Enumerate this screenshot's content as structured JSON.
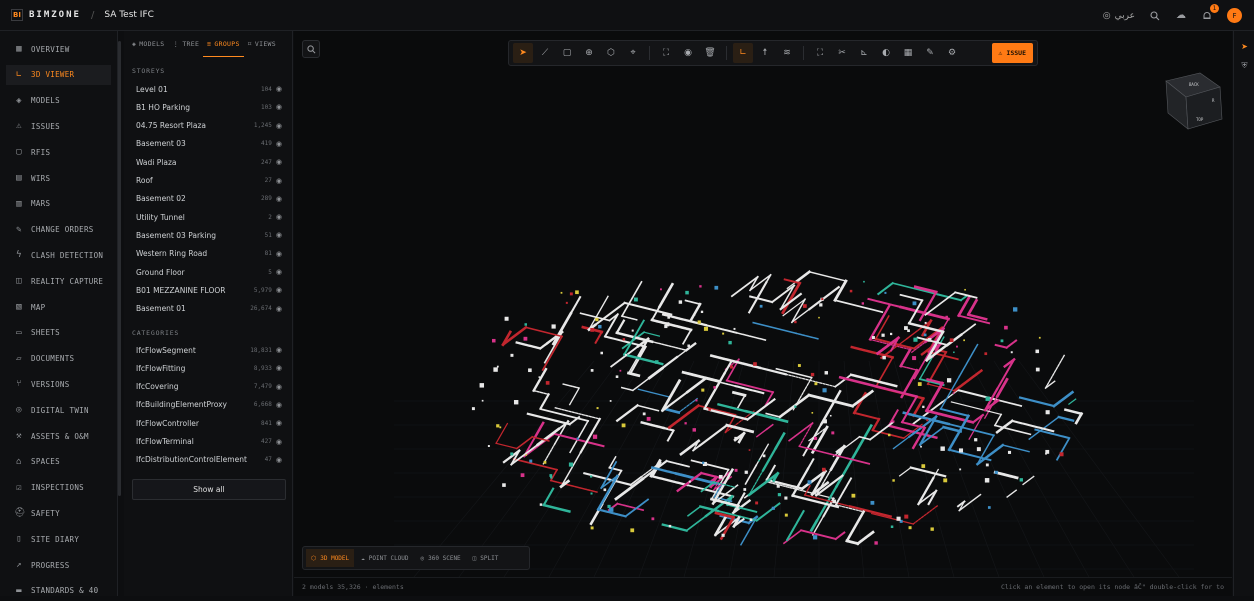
{
  "topbar": {
    "logo_mark": "BI",
    "logo_text": "BIMZONE",
    "separator": "/",
    "project": "SA Test IFC",
    "language": "عربي",
    "notification_count": "1",
    "avatar_initial": "F"
  },
  "sidebar": {
    "items": [
      {
        "label": "OVERVIEW",
        "icon": "grid-icon"
      },
      {
        "label": "3D VIEWER",
        "icon": "axes-icon",
        "active": true
      },
      {
        "label": "MODELS",
        "icon": "layers-icon"
      },
      {
        "label": "ISSUES",
        "icon": "warning-icon"
      },
      {
        "label": "RFIS",
        "icon": "message-icon"
      },
      {
        "label": "WIRS",
        "icon": "clipboard-icon"
      },
      {
        "label": "MARS",
        "icon": "box-icon"
      },
      {
        "label": "CHANGE ORDERS",
        "icon": "file-edit-icon"
      },
      {
        "label": "CLASH DETECTION",
        "icon": "bolt-icon"
      },
      {
        "label": "REALITY CAPTURE",
        "icon": "camera-icon"
      },
      {
        "label": "MAP",
        "icon": "map-icon"
      },
      {
        "label": "SHEETS",
        "icon": "sheets-icon"
      },
      {
        "label": "DOCUMENTS",
        "icon": "folder-icon"
      },
      {
        "label": "VERSIONS",
        "icon": "branch-icon"
      },
      {
        "label": "DIGITAL TWIN",
        "icon": "target-icon"
      },
      {
        "label": "ASSETS & O&M",
        "icon": "wrench-icon"
      },
      {
        "label": "SPACES",
        "icon": "spaces-icon"
      },
      {
        "label": "INSPECTIONS",
        "icon": "checklist-icon"
      },
      {
        "label": "SAFETY",
        "icon": "helmet-icon"
      },
      {
        "label": "SITE DIARY",
        "icon": "book-icon"
      },
      {
        "label": "PROGRESS",
        "icon": "trend-icon"
      },
      {
        "label": "STANDARDS & 40",
        "icon": "ruler-icon"
      }
    ]
  },
  "panel": {
    "tabs": [
      {
        "label": "MODELS",
        "icon": "layers-icon"
      },
      {
        "label": "TREE",
        "icon": "tree-icon"
      },
      {
        "label": "GROUPS",
        "icon": "stack-icon",
        "active": true
      },
      {
        "label": "VIEWS",
        "icon": "bookmark-icon"
      }
    ],
    "storeys_title": "STOREYS",
    "storeys": [
      {
        "label": "Level 01",
        "count": "104"
      },
      {
        "label": "B1 HO Parking",
        "count": "103"
      },
      {
        "label": "04.75 Resort Plaza",
        "count": "1,245"
      },
      {
        "label": "Basement 03",
        "count": "419"
      },
      {
        "label": "Wadi Plaza",
        "count": "247"
      },
      {
        "label": "Roof",
        "count": "27"
      },
      {
        "label": "Basement 02",
        "count": "289"
      },
      {
        "label": "Utility Tunnel",
        "count": "2"
      },
      {
        "label": "Basement 03 Parking",
        "count": "51"
      },
      {
        "label": "Western Ring Road",
        "count": "81"
      },
      {
        "label": "Ground Floor",
        "count": "5"
      },
      {
        "label": "B01 MEZZANINE FLOOR",
        "count": "5,979"
      },
      {
        "label": "Basement 01",
        "count": "26,674"
      }
    ],
    "categories_title": "CATEGORIES",
    "categories": [
      {
        "label": "IfcFlowSegment",
        "count": "18,831"
      },
      {
        "label": "IfcFlowFitting",
        "count": "8,933"
      },
      {
        "label": "IfcCovering",
        "count": "7,479"
      },
      {
        "label": "IfcBuildingElementProxy",
        "count": "6,668"
      },
      {
        "label": "IfcFlowController",
        "count": "841"
      },
      {
        "label": "IfcFlowTerminal",
        "count": "427"
      },
      {
        "label": "IfcDistributionControlElement",
        "count": "47"
      }
    ],
    "show_all": "Show all"
  },
  "viewer": {
    "issue_label": "ISSUE",
    "cube_top": "BACK",
    "cube_right": "R",
    "cube_front": "TOP",
    "modes": [
      {
        "label": "3D MODEL",
        "icon": "cube-icon",
        "active": true
      },
      {
        "label": "POINT CLOUD",
        "icon": "cloud-icon"
      },
      {
        "label": "360 SCENE",
        "icon": "globe-icon"
      },
      {
        "label": "SPLIT",
        "icon": "split-icon"
      }
    ]
  },
  "status": {
    "left": "2 models 35,326 · elements",
    "right": "Click an element to open its node âĈ\" double-click for to"
  },
  "colors": {
    "accent": "#ff7a14",
    "bg": "#0d0e10",
    "pipe_white": "#e8e8e8",
    "pipe_blue": "#3d8fc7",
    "pipe_magenta": "#d8328a",
    "pipe_red": "#c2262e",
    "pipe_teal": "#2fb59a"
  }
}
